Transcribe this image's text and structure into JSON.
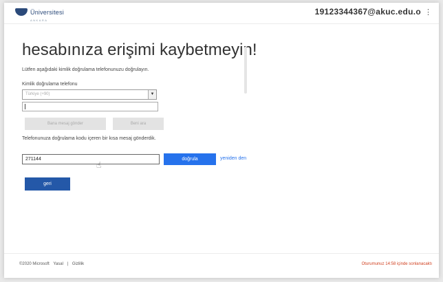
{
  "header": {
    "logo_text": "Üniversitesi",
    "logo_sub": "ANKARA",
    "user_email": "19123344367@akuc.edu.o",
    "more_icon": "ellipsis-icon"
  },
  "main": {
    "title": "hesabınıza erişimi kaybetmeyin!",
    "instructions": "Lütfen aşağıdaki kimlik doğrulama telefonunuzu doğrulayın.",
    "phone_label": "Kimlik doğrulama telefonu",
    "country_select": {
      "value": "Türkiye (+90)"
    },
    "phone_input": {
      "value": ""
    },
    "sms_button": "Bana mesaj gönder",
    "call_button": "Beni ara",
    "sent_message": "Telefonunuza doğrulama kodu içeren bir kısa mesaj gönderdik.",
    "code_input": {
      "value": "271144"
    },
    "verify_button": "doğrula",
    "resend_link": "yeniden den",
    "back_button": "geri"
  },
  "footer": {
    "copyright": "©2020 Microsoft",
    "legal": "Yasal",
    "separator": "|",
    "privacy": "Gizlilik",
    "session_notice": "Oturumunuz 14:58 içinde sonlanacaktı"
  },
  "colors": {
    "accent": "#2672ec",
    "back_button": "#2458a8",
    "warning": "#d04020"
  }
}
